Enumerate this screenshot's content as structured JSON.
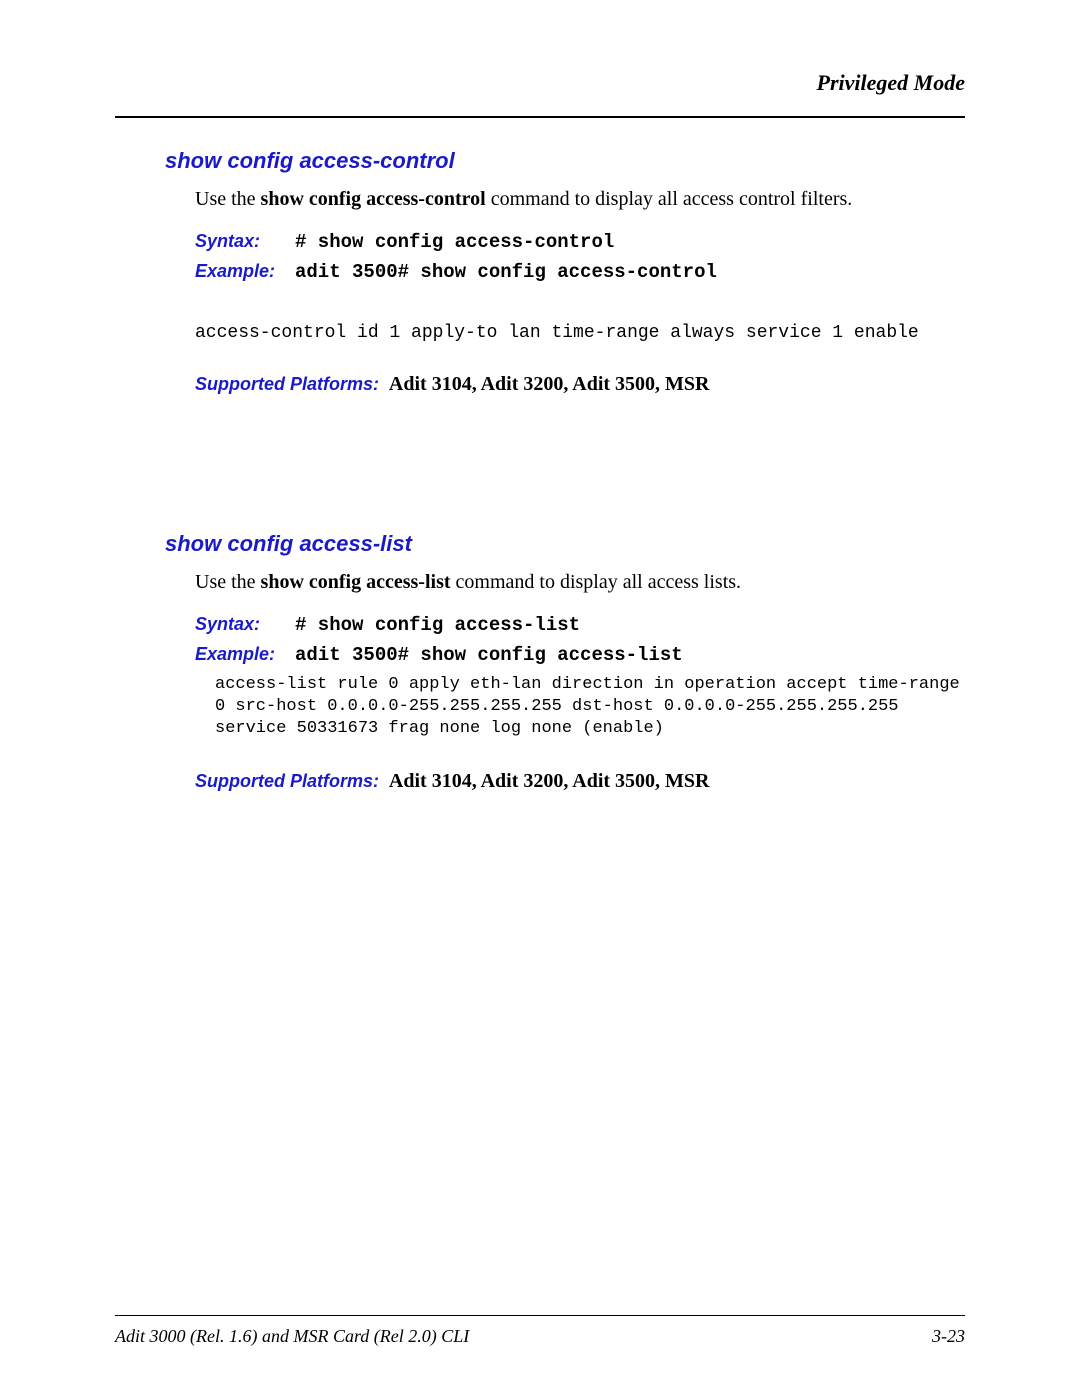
{
  "header": {
    "mode": "Privileged Mode"
  },
  "sections": [
    {
      "title": "show config access-control",
      "desc_prefix": "Use the ",
      "desc_bold": "show config access-control",
      "desc_suffix": " command to display all access control filters.",
      "syntax_label": "Syntax:",
      "syntax_value": "# show config access-control",
      "example_label": "Example:",
      "example_value": "adit 3500# show config access-control",
      "output": "access-control id 1 apply-to lan time-range always service 1 enable",
      "platforms_label": "Supported Platforms:",
      "platforms_value": " Adit 3104, Adit 3200, Adit 3500, MSR"
    },
    {
      "title": "show config access-list",
      "desc_prefix": "Use the ",
      "desc_bold": "show config access-list",
      "desc_suffix": " command to display all access lists.",
      "syntax_label": "Syntax:",
      "syntax_value": "# show config access-list",
      "example_label": "Example:",
      "example_value": "adit 3500# show config access-list",
      "output": "access-list rule 0 apply eth-lan direction in operation accept time-range 0 src-host 0.0.0.0-255.255.255.255 dst-host 0.0.0.0-255.255.255.255 service 50331673 frag none log none (enable)",
      "platforms_label": "Supported Platforms:",
      "platforms_value": " Adit 3104, Adit 3200, Adit 3500, MSR"
    }
  ],
  "footer": {
    "left": "Adit 3000 (Rel. 1.6) and MSR Card (Rel 2.0) CLI",
    "right": "3-23"
  }
}
